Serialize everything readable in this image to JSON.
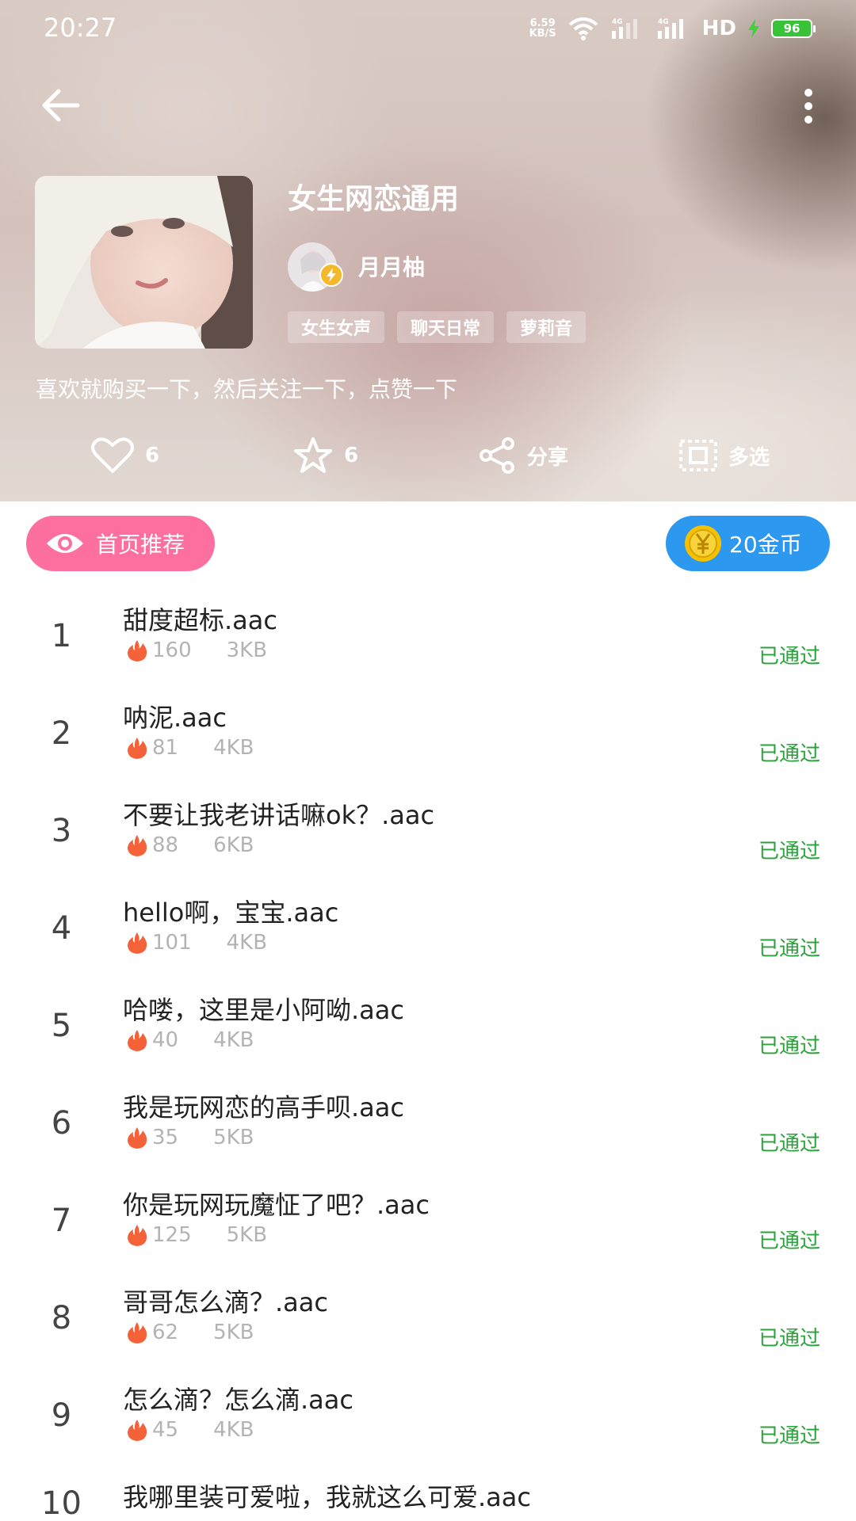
{
  "status_bar": {
    "time": "20:27",
    "net_speed_value": "6.59",
    "net_speed_unit": "KB/S",
    "signal_1_label": "4G",
    "signal_2_label": "4G",
    "hd_label": "HD",
    "battery": "96"
  },
  "header": {
    "title": "女生网恋通用",
    "author": "月月柚",
    "tags": [
      "女生女声",
      "聊天日常",
      "萝莉音"
    ],
    "description": "喜欢就购买一下，然后关注一下，点赞一下",
    "likes": "6",
    "favorites": "6",
    "share_label": "分享",
    "multiselect_label": "多选"
  },
  "recommend": {
    "label": "首页推荐"
  },
  "coin": {
    "label": "20金币"
  },
  "colors": {
    "recommend_pink": "#fc6f9e",
    "coin_blue": "#2c98ef",
    "approved_green": "#2aa23a",
    "fire_orange": "#f4623a"
  },
  "items": [
    {
      "num": "1",
      "name": "甜度超标.aac",
      "plays": "160",
      "size": "3KB",
      "status": "已通过"
    },
    {
      "num": "2",
      "name": "呐泥.aac",
      "plays": "81",
      "size": "4KB",
      "status": "已通过"
    },
    {
      "num": "3",
      "name": "不要让我老讲话嘛ok？.aac",
      "plays": "88",
      "size": "6KB",
      "status": "已通过"
    },
    {
      "num": "4",
      "name": "hello啊，宝宝.aac",
      "plays": "101",
      "size": "4KB",
      "status": "已通过"
    },
    {
      "num": "5",
      "name": "哈喽，这里是小阿呦.aac",
      "plays": "40",
      "size": "4KB",
      "status": "已通过"
    },
    {
      "num": "6",
      "name": "我是玩网恋的高手呗.aac",
      "plays": "35",
      "size": "5KB",
      "status": "已通过"
    },
    {
      "num": "7",
      "name": "你是玩网玩魔怔了吧？.aac",
      "plays": "125",
      "size": "5KB",
      "status": "已通过"
    },
    {
      "num": "8",
      "name": "哥哥怎么滴？.aac",
      "plays": "62",
      "size": "5KB",
      "status": "已通过"
    },
    {
      "num": "9",
      "name": "怎么滴？怎么滴.aac",
      "plays": "45",
      "size": "4KB",
      "status": "已通过"
    },
    {
      "num": "10",
      "name": "我哪里装可爱啦，我就这么可爱.aac",
      "plays": "",
      "size": "",
      "status": ""
    }
  ]
}
